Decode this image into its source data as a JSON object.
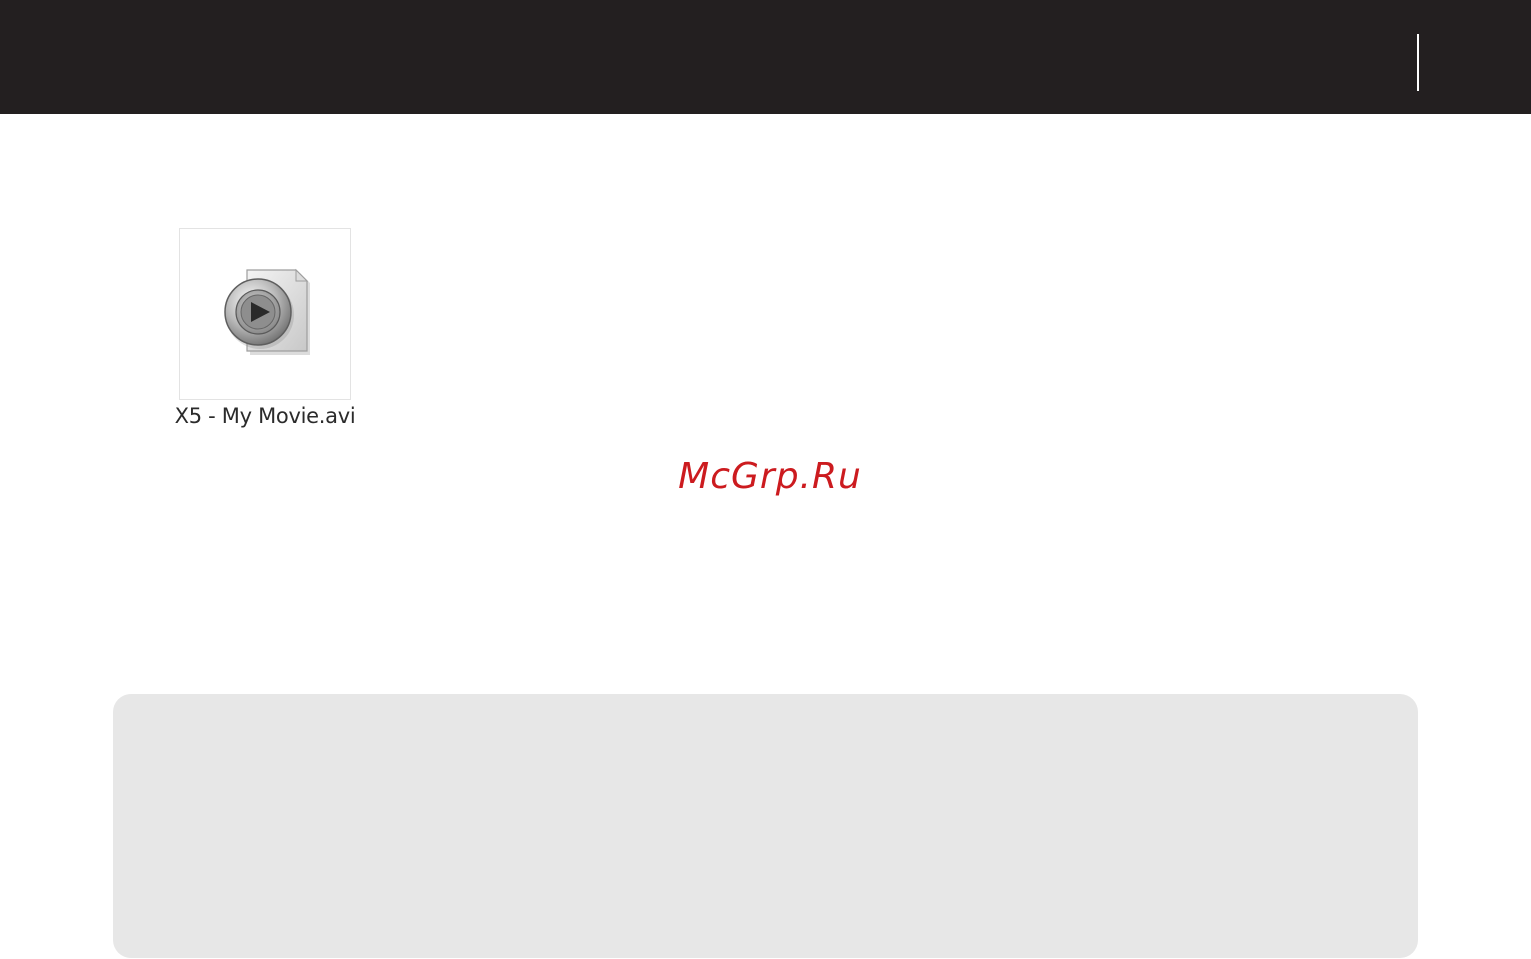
{
  "header": {
    "background_color": "#231f20"
  },
  "file": {
    "name": "X5 - My Movie.avi",
    "icon": "video-file-icon"
  },
  "watermark": {
    "text": "McGrp.Ru",
    "color": "#cc1b1f"
  },
  "note_panel": {
    "background_color": "#e7e7e7"
  }
}
